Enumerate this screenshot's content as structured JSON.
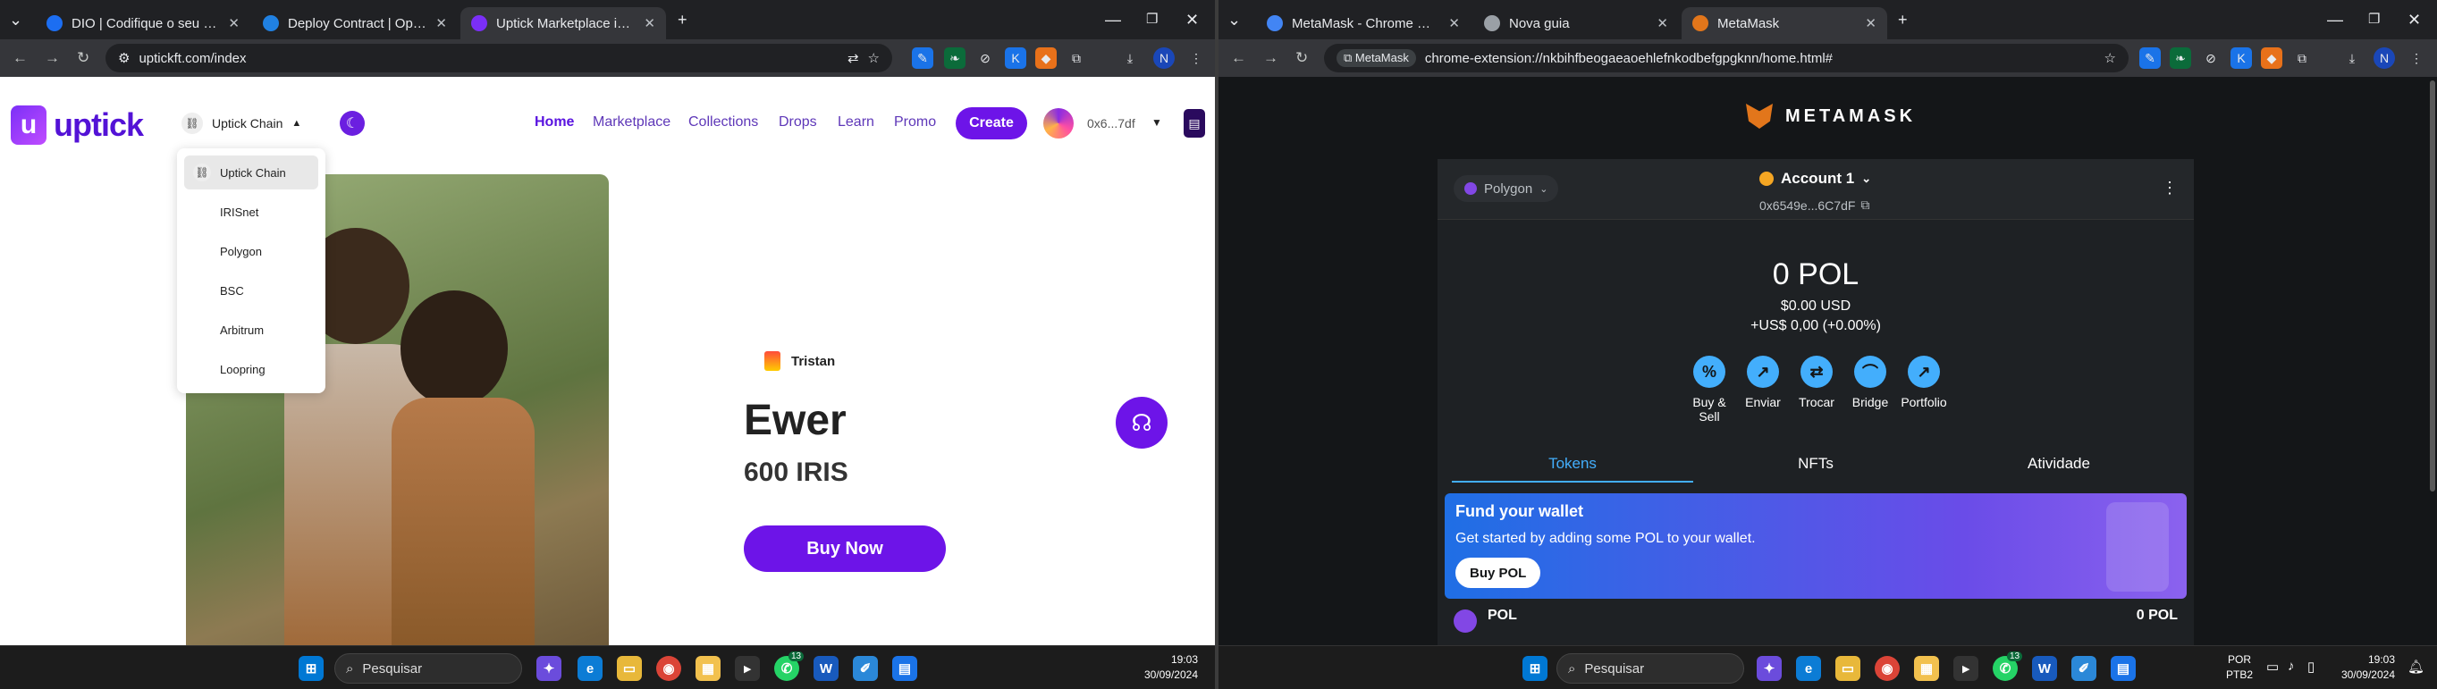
{
  "left": {
    "tabs": [
      {
        "title": "DIO | Codifique o seu futuro gl",
        "color": "#1c6ef2"
      },
      {
        "title": "Deploy Contract | OpenSea",
        "color": "#2081e2"
      },
      {
        "title": "Uptick Marketplace is dedicate",
        "color": "#7b2ff7"
      }
    ],
    "url": "uptickft.com/index",
    "page": {
      "logo": "uptick",
      "chain_selector": "Uptick Chain",
      "nav": [
        "Home",
        "Marketplace",
        "Collections",
        "Drops",
        "Learn",
        "Promo"
      ],
      "create": "Create",
      "address": "0x6...7df",
      "dropdown": [
        "Uptick Chain",
        "IRISnet",
        "Polygon",
        "BSC",
        "Arbitrum",
        "Loopring"
      ],
      "owner": "Tristan",
      "nft_name": "Ewer",
      "price": "600 IRIS",
      "buy_button": "Buy Now"
    },
    "taskbar": {
      "search": "Pesquisar",
      "time": "19:03",
      "date": "30/09/2024",
      "badge": "13"
    }
  },
  "right": {
    "tabs": [
      {
        "title": "MetaMask - Chrome Web Store",
        "color": "#4285f4"
      },
      {
        "title": "Nova guia",
        "color": "#9aa0a6"
      },
      {
        "title": "MetaMask",
        "color": "#e2761b"
      }
    ],
    "url_chip": "MetaMask",
    "url": "chrome-extension://nkbihfbeogaeaoehlefnkodbefgpgknn/home.html#",
    "mm": {
      "brand": "METAMASK",
      "network": "Polygon",
      "account": "Account 1",
      "account_address": "0x6549e...6C7dF",
      "balance": "0 POL",
      "fiat": "$0.00 USD",
      "change": "+US$ 0,00 (+0.00%)",
      "actions": [
        "Buy & Sell",
        "Enviar",
        "Trocar",
        "Bridge",
        "Portfolio"
      ],
      "tabs": [
        "Tokens",
        "NFTs",
        "Atividade"
      ],
      "fund_title": "Fund your wallet",
      "fund_sub": "Get started by adding some POL to your wallet.",
      "fund_button": "Buy POL",
      "token_name": "POL",
      "token_balance": "0 POL"
    },
    "taskbar": {
      "search": "Pesquisar",
      "lang1": "POR",
      "lang2": "PTB2",
      "time": "19:03",
      "date": "30/09/2024",
      "badge": "13"
    }
  }
}
